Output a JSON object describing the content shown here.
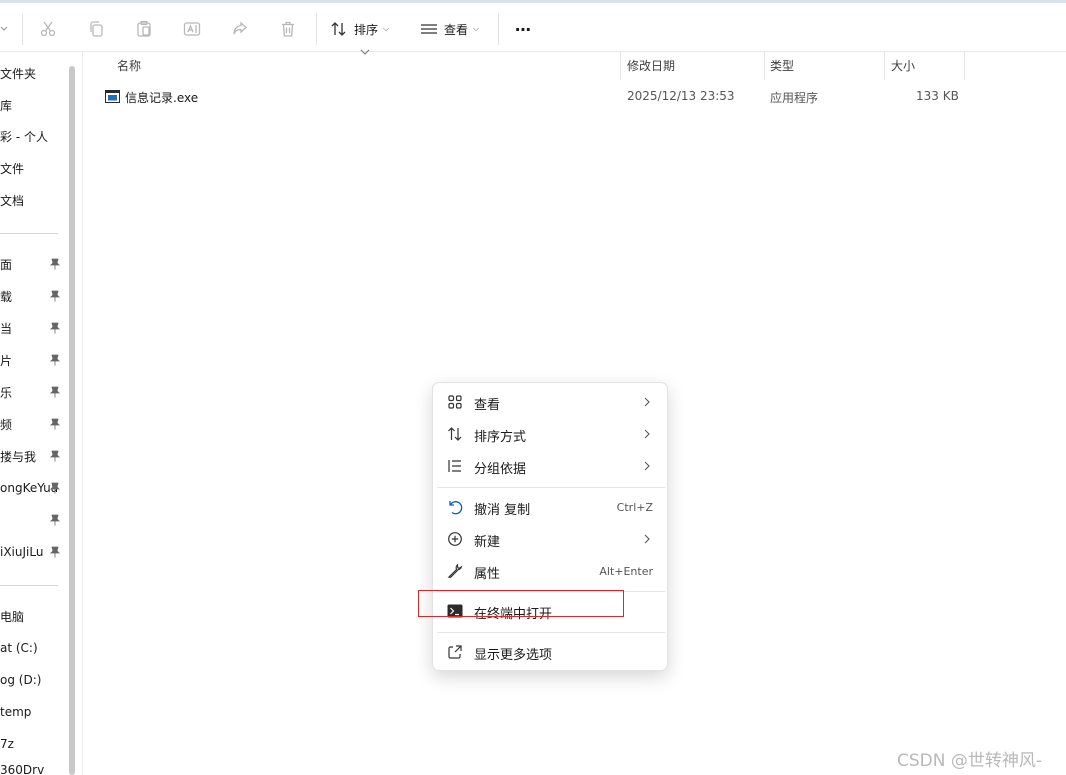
{
  "toolbar": {
    "sort_label": "排序",
    "view_label": "查看",
    "more_label": "⋯"
  },
  "sidebar": {
    "quick_items": [
      "文件夹",
      "库",
      "彩 - 个人",
      "文件",
      "文档"
    ],
    "pinned_items": [
      "面",
      "载",
      "当",
      "片",
      "乐",
      "频",
      "搂与我",
      "ongKeYua",
      "",
      "iXiuJiLu"
    ],
    "drive_items": [
      "电脑",
      "at (C:)",
      "og (D:)",
      "temp",
      "7z",
      "360Drv"
    ]
  },
  "columns": {
    "name": "名称",
    "modified": "修改日期",
    "type": "类型",
    "size": "大小"
  },
  "files": [
    {
      "name": "信息记录.exe",
      "modified": "2025/12/13 23:53",
      "type": "应用程序",
      "size": "133 KB"
    }
  ],
  "context_menu": {
    "view": "查看",
    "sort": "排序方式",
    "group": "分组依据",
    "undo": "撤消 复制",
    "undo_shortcut": "Ctrl+Z",
    "new": "新建",
    "properties": "属性",
    "properties_shortcut": "Alt+Enter",
    "terminal": "在终端中打开",
    "more": "显示更多选项"
  },
  "watermark": "CSDN @世转神风-",
  "colors": {
    "accent": "#0063b1",
    "highlight_box": "#e0242a",
    "exe_icon": "#1d6fbf"
  }
}
